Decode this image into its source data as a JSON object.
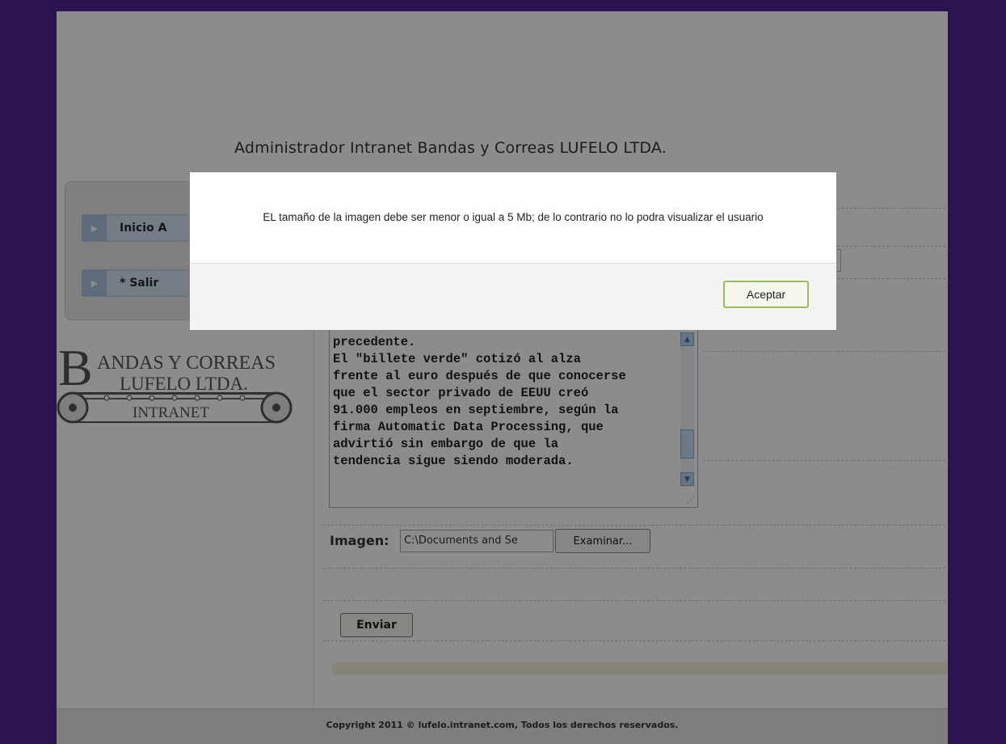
{
  "header": {
    "title": "Administrador Intranet Bandas y Correas LUFELO LTDA."
  },
  "menu": {
    "items": [
      {
        "label": "Inicio A"
      },
      {
        "label": "* Salir"
      }
    ]
  },
  "logo": {
    "line1": "ANDAS Y CORREAS",
    "initial": "B",
    "line2": "LUFELO LTDA.",
    "line3": "INTRANET"
  },
  "form": {
    "content_text": "precedente.\nEl \"billete verde\" cotizó al alza\nfrente al euro después de que conocerse\nque el sector privado de EEUU creó\n91.000 empleos en septiembre, según la\nfirma Automatic Data Processing, que\nadvirtió sin embargo de que la\ntendencia sigue siendo moderada.",
    "image_label": "Imagen:",
    "image_value": "C:\\Documents and Se",
    "browse_label": "Examinar...",
    "submit_label": "Enviar"
  },
  "footer": {
    "text": "Copyright 2011 © lufelo.intranet.com, Todos los derechos reservados."
  },
  "dialog": {
    "message": "EL tamaño de la imagen debe ser menor o igual a 5 Mb; de lo contrario no lo podra visualizar el usuario",
    "ok_label": "Aceptar"
  },
  "colors": {
    "frame": "#4f2394",
    "accent_button_border": "#9bbd55",
    "menu_item": "#d3e3f4"
  },
  "icons": {
    "menu_arrow": "play-arrow-icon",
    "scroll_up": "chevron-up-icon",
    "scroll_down": "chevron-down-icon"
  }
}
